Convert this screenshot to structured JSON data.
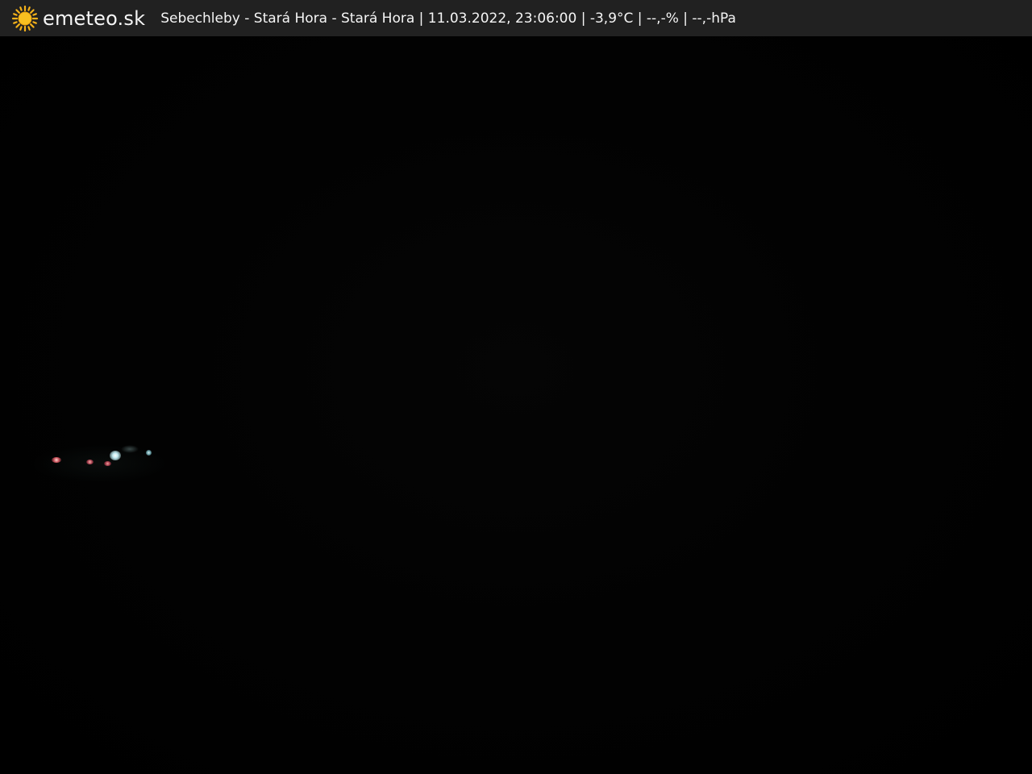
{
  "header": {
    "brand": "emeteo.sk",
    "caption": "Sebechleby - Stará Hora - Stará Hora | 11.03.2022, 23:06:00 | -3,9°C | --,-% | --,-hPa",
    "icon": "sun-icon",
    "icon_color": "#f5b21a"
  },
  "scene": {
    "background_color": "#010101"
  }
}
